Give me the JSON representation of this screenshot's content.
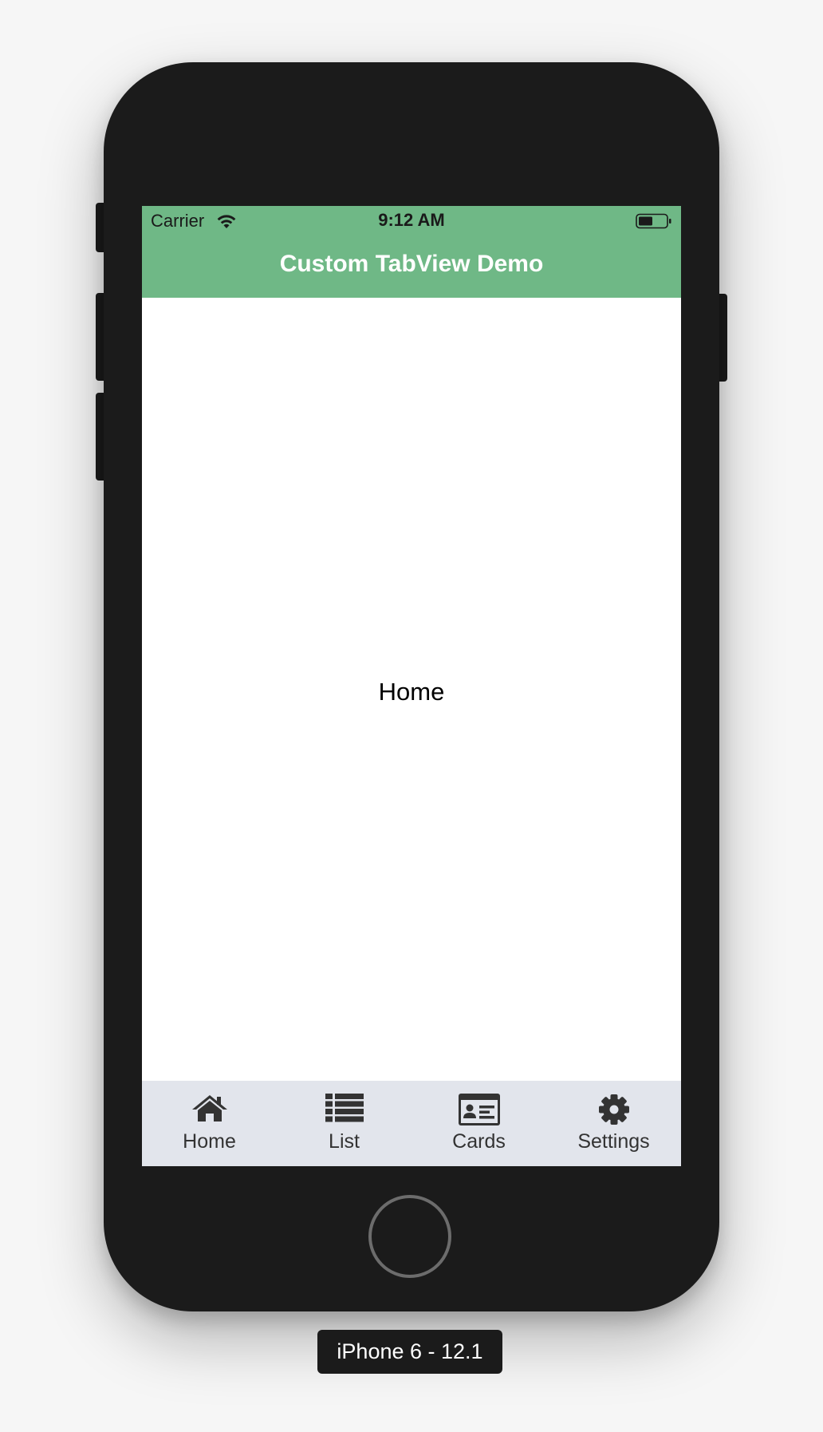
{
  "status_bar": {
    "carrier": "Carrier",
    "time": "9:12 AM",
    "wifi_icon": "wifi-icon",
    "battery_icon": "battery-icon"
  },
  "nav": {
    "title": "Custom TabView Demo"
  },
  "content": {
    "label": "Home"
  },
  "tabs": [
    {
      "label": "Home",
      "icon": "home-icon"
    },
    {
      "label": "List",
      "icon": "list-icon"
    },
    {
      "label": "Cards",
      "icon": "id-card-icon"
    },
    {
      "label": "Settings",
      "icon": "gear-icon"
    }
  ],
  "device": {
    "caption": "iPhone 6 - 12.1"
  },
  "colors": {
    "header_green": "#6fb886",
    "tabbar_bg": "#e2e5ec",
    "phone_body": "#1b1b1b",
    "tab_icon": "#333333"
  }
}
